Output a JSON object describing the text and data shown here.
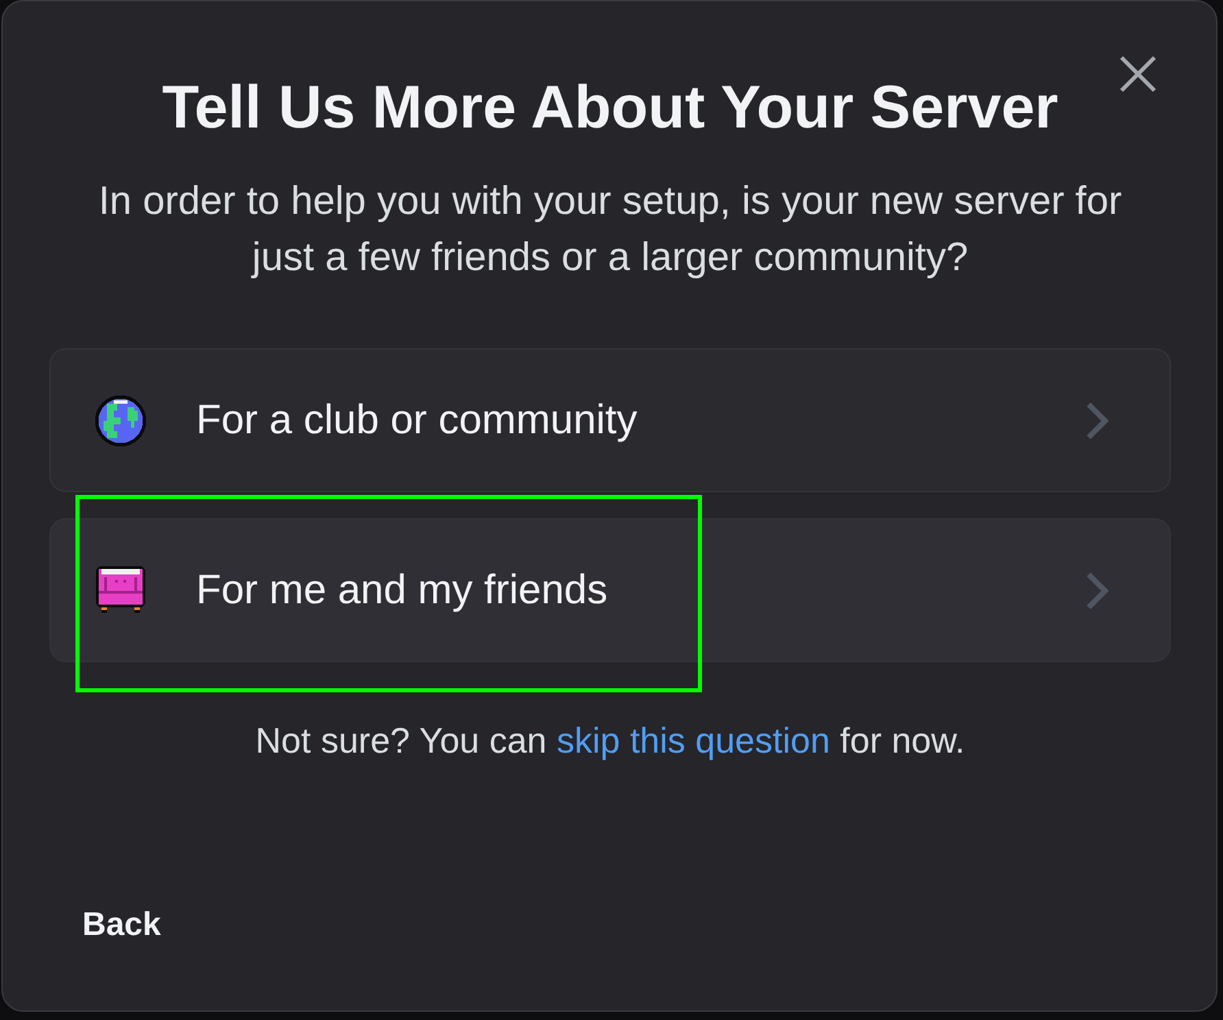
{
  "dialog": {
    "title": "Tell Us More About Your Server",
    "subtitle": "In order to help you with your setup, is your new server for just a few friends or a larger community?"
  },
  "options": [
    {
      "label": "For a club or community",
      "kind": "globe",
      "highlighted": false
    },
    {
      "label": "For me and my friends",
      "kind": "couch",
      "highlighted": true
    }
  ],
  "footer": {
    "text_before": "Not sure? You can",
    "link": "skip this question",
    "text_after": "for now."
  },
  "back_button": "Back"
}
